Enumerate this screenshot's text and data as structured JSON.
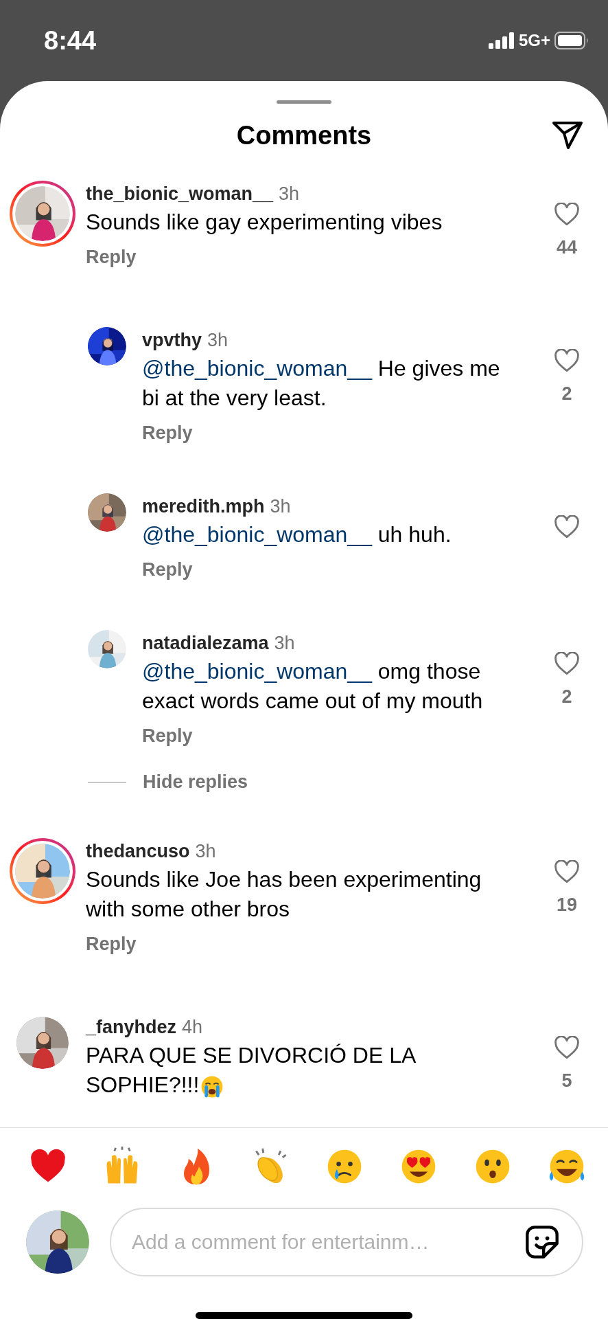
{
  "status_bar": {
    "time": "8:44",
    "network": "5G+"
  },
  "sheet": {
    "title": "Comments"
  },
  "comments": [
    {
      "user": "the_bionic_woman__",
      "time": "3h",
      "text": "Sounds like gay experimenting vibes",
      "likes": "44",
      "liked": false,
      "story_ring": true,
      "reply_label": "Reply",
      "toggle": "Hide replies",
      "children": [
        {
          "user": "vpvthy",
          "time": "3h",
          "mention": "@the_bionic_woman__",
          "text": "He gives me bi at the very least.",
          "likes": "2",
          "liked": false,
          "story_ring": false,
          "reply_label": "Reply"
        },
        {
          "user": "meredith.mph",
          "time": "3h",
          "mention": "@the_bionic_woman__",
          "text": "uh huh.",
          "liked": false,
          "story_ring": false,
          "reply_label": "Reply"
        },
        {
          "user": "natadialezama",
          "time": "3h",
          "mention": "@the_bionic_woman__",
          "text": "omg those exact words came out of my mouth",
          "likes": "2",
          "liked": false,
          "story_ring": false,
          "reply_label": "Reply"
        }
      ]
    },
    {
      "user": "thedancuso",
      "time": "3h",
      "text": "Sounds like Joe has been experimenting with some other bros",
      "likes": "19",
      "liked": false,
      "story_ring": true,
      "reply_label": "Reply"
    },
    {
      "user": "_fanyhdez",
      "time": "4h",
      "text": "PARA QUE SE DIVORCIÓ DE LA SOPHIE?!!!",
      "emoji": {
        "kind": "loudly-crying"
      },
      "likes": "5",
      "liked": false,
      "story_ring": false
    }
  ],
  "reactions": [
    {
      "kind": "heart"
    },
    {
      "kind": "raised-hands"
    },
    {
      "kind": "fire"
    },
    {
      "kind": "clap"
    },
    {
      "kind": "crying"
    },
    {
      "kind": "heart-eyes"
    },
    {
      "kind": "surprised"
    },
    {
      "kind": "laughing"
    }
  ],
  "composer": {
    "placeholder": "Add a comment for entertainm…"
  }
}
